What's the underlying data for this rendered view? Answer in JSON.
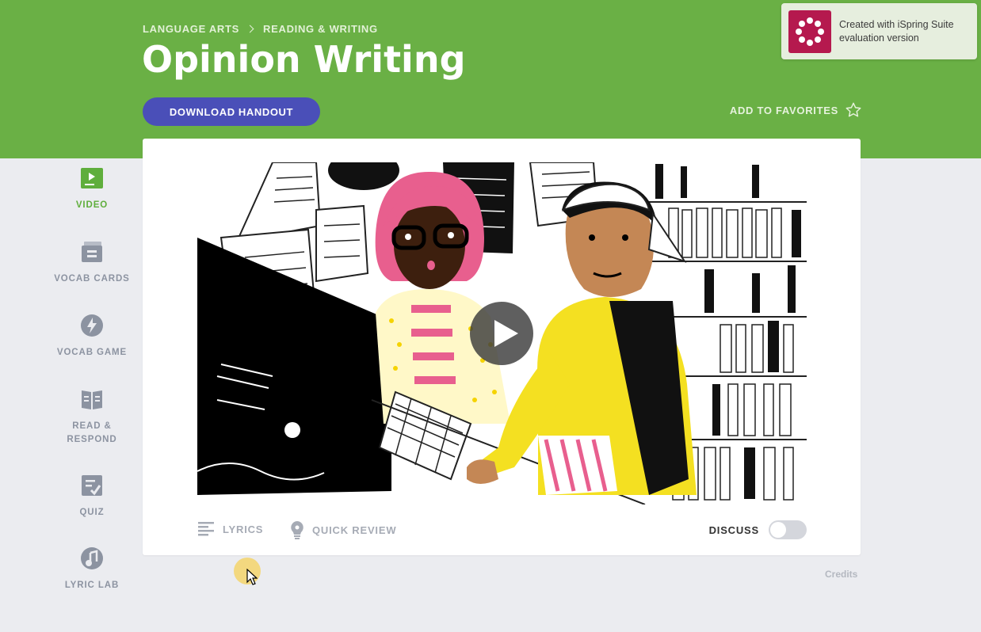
{
  "breadcrumb": [
    "LANGUAGE ARTS",
    "READING & WRITING"
  ],
  "title": "Opinion Writing",
  "download_label": "DOWNLOAD HANDOUT",
  "favorites_label": "ADD TO FAVORITES",
  "toast": {
    "text": "Created with iSpring Suite evaluation version"
  },
  "nav": [
    {
      "label": "VIDEO",
      "icon": "video-icon",
      "active": true
    },
    {
      "label": "VOCAB CARDS",
      "icon": "vocab-cards-icon"
    },
    {
      "label": "VOCAB GAME",
      "icon": "lightning-icon"
    },
    {
      "label": "READ &\nRESPOND",
      "line1": "READ &",
      "line2": "RESPOND",
      "icon": "book-icon"
    },
    {
      "label": "QUIZ",
      "icon": "quiz-icon"
    },
    {
      "label": "LYRIC LAB",
      "icon": "music-note-icon"
    }
  ],
  "footer": {
    "lyrics_label": "LYRICS",
    "quick_review_label": "QUICK REVIEW",
    "discuss_label": "DISCUSS",
    "discuss_enabled": false
  },
  "credits_label": "Credits",
  "colors": {
    "header": "#6ab045",
    "button": "#4a4fb8",
    "active_nav": "#5fae3c",
    "toast_logo": "#b5194e"
  }
}
